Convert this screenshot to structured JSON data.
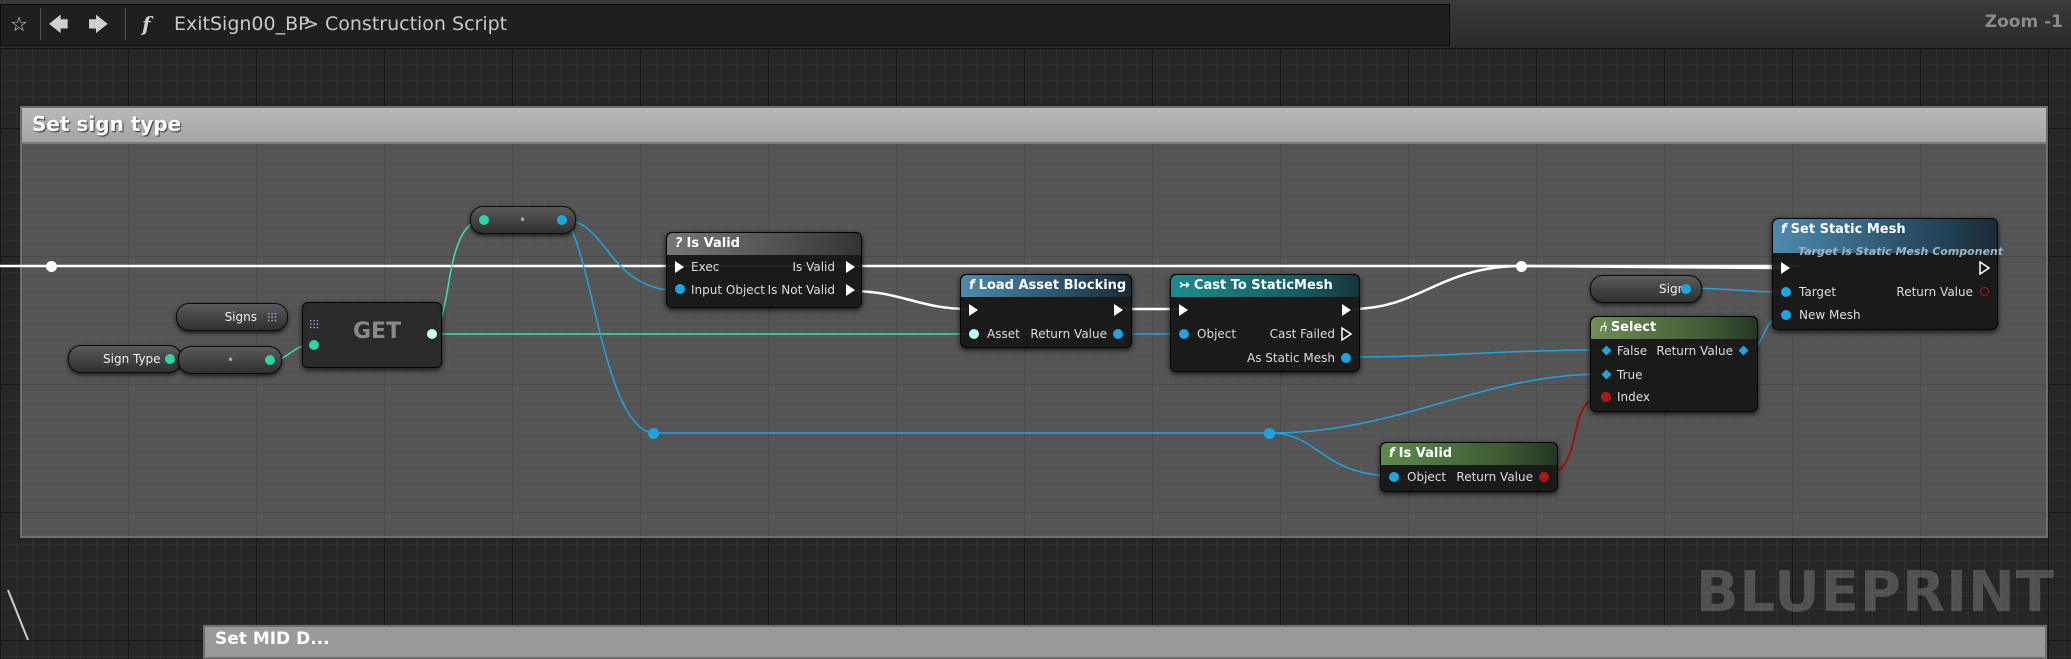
{
  "toolbar": {
    "favorite_icon": "star-icon",
    "back_icon": "arrow-left-icon",
    "forward_icon": "arrow-right-icon",
    "function_icon_glyph": "f",
    "breadcrumb": [
      "ExitSign00_BP",
      "Construction Script"
    ],
    "breadcrumb_separator": ">",
    "zoom_label": "Zoom -1"
  },
  "comment": {
    "title": "Set sign type"
  },
  "comment_below": {
    "title": "Set MID D..."
  },
  "variables": {
    "signs": "Signs",
    "sign_type": "Sign Type",
    "sign": "Sign"
  },
  "get_node": {
    "label": "GET"
  },
  "nodes": {
    "is_valid_macro": {
      "title": "Is Valid",
      "icon": "?",
      "pins": {
        "exec": "Exec",
        "input_object": "Input Object",
        "is_valid": "Is Valid",
        "is_not_valid": "Is Not Valid"
      }
    },
    "load_asset_blocking": {
      "title": "Load Asset Blocking",
      "icon": "f",
      "pins": {
        "asset": "Asset",
        "return_value": "Return Value"
      }
    },
    "cast_to_static_mesh": {
      "title": "Cast To StaticMesh",
      "icon": "↣",
      "pins": {
        "object": "Object",
        "cast_failed": "Cast Failed",
        "as_static_mesh": "As Static Mesh"
      }
    },
    "select": {
      "title": "Select",
      "icon": "⑃",
      "pins": {
        "false": "False",
        "true": "True",
        "index": "Index",
        "return_value": "Return Value"
      }
    },
    "is_valid_func": {
      "title": "Is Valid",
      "icon": "f",
      "pins": {
        "object": "Object",
        "return_value": "Return Value"
      }
    },
    "set_static_mesh": {
      "title": "Set Static Mesh",
      "icon": "f",
      "subtitle": "Target is Static Mesh Component",
      "pins": {
        "target": "Target",
        "new_mesh": "New Mesh",
        "return_value": "Return Value"
      }
    }
  },
  "watermark": "BLUEPRINT",
  "colors": {
    "exec": "#ffffff",
    "object_pin": "#1ea5e0",
    "soft_object_pin": "#2fd3a8",
    "bool_pin": "#b01818",
    "function_header": "#4e8aae",
    "cast_header": "#1e8c8c",
    "select_header": "#6f8f56"
  }
}
